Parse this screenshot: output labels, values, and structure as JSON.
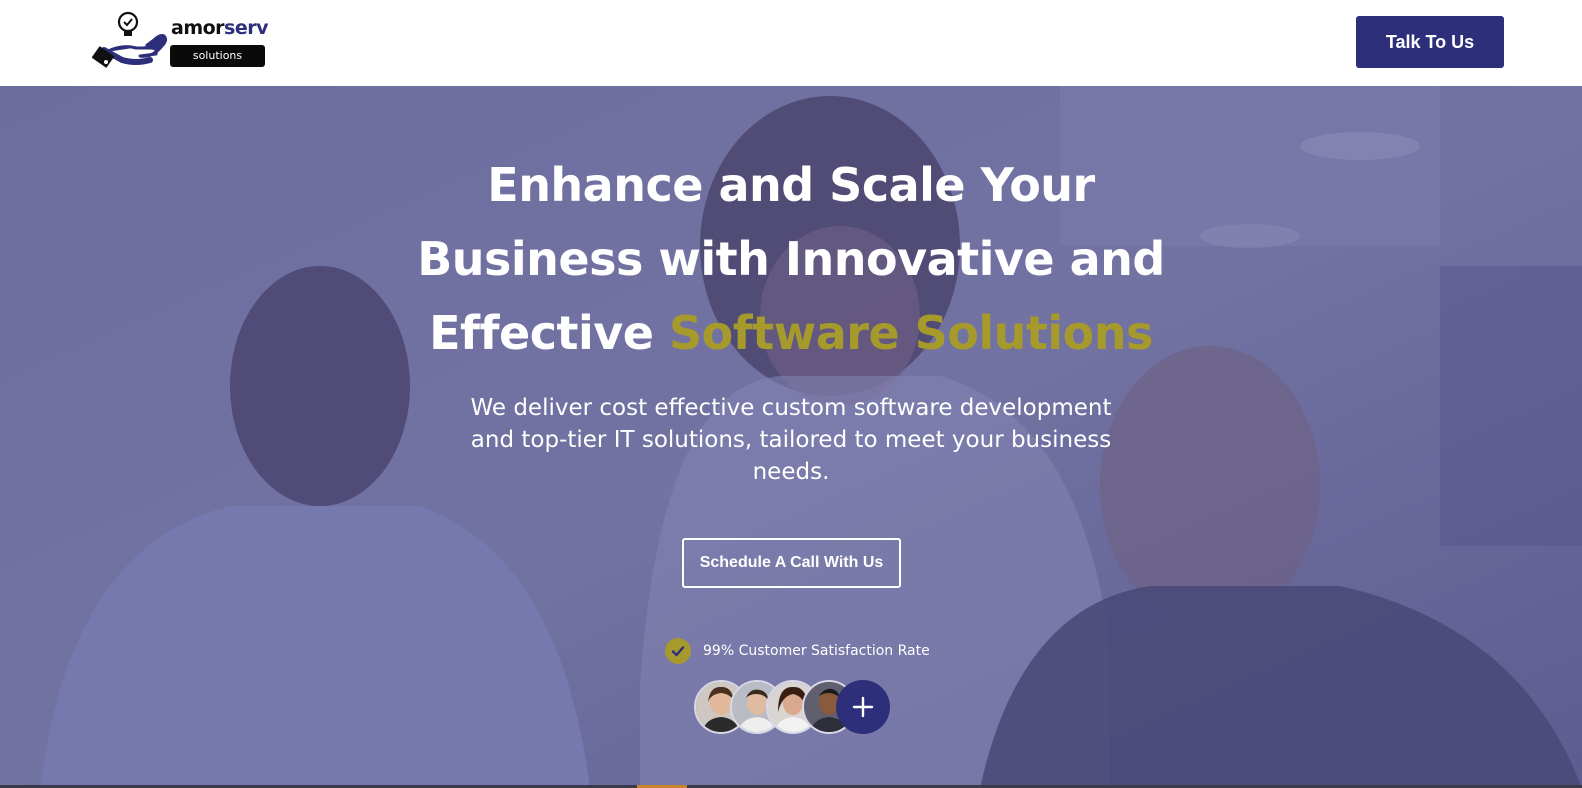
{
  "header": {
    "logo": {
      "word_main": "amor",
      "word_accent": "serv",
      "tagline": "solutions"
    },
    "talk_button_label": "Talk To Us"
  },
  "hero": {
    "headline_line1": "Enhance and Scale Your",
    "headline_line2": "Business with Innovative and",
    "headline_line3_plain": "Effective ",
    "headline_line3_accent": "Software Solutions",
    "subtext": "We deliver cost effective custom software development and top-tier IT solutions, tailored to meet your business needs.",
    "cta_label": "Schedule A Call With Us",
    "satisfaction_text": "99% Customer Satisfaction Rate"
  },
  "colors": {
    "brand_navy": "#2d2f7a",
    "accent_olive": "#a69a2c",
    "overlay": "#5c5c96"
  },
  "icons": [
    "lightbulb-check-icon",
    "hand-icon",
    "check-icon",
    "plus-icon"
  ]
}
